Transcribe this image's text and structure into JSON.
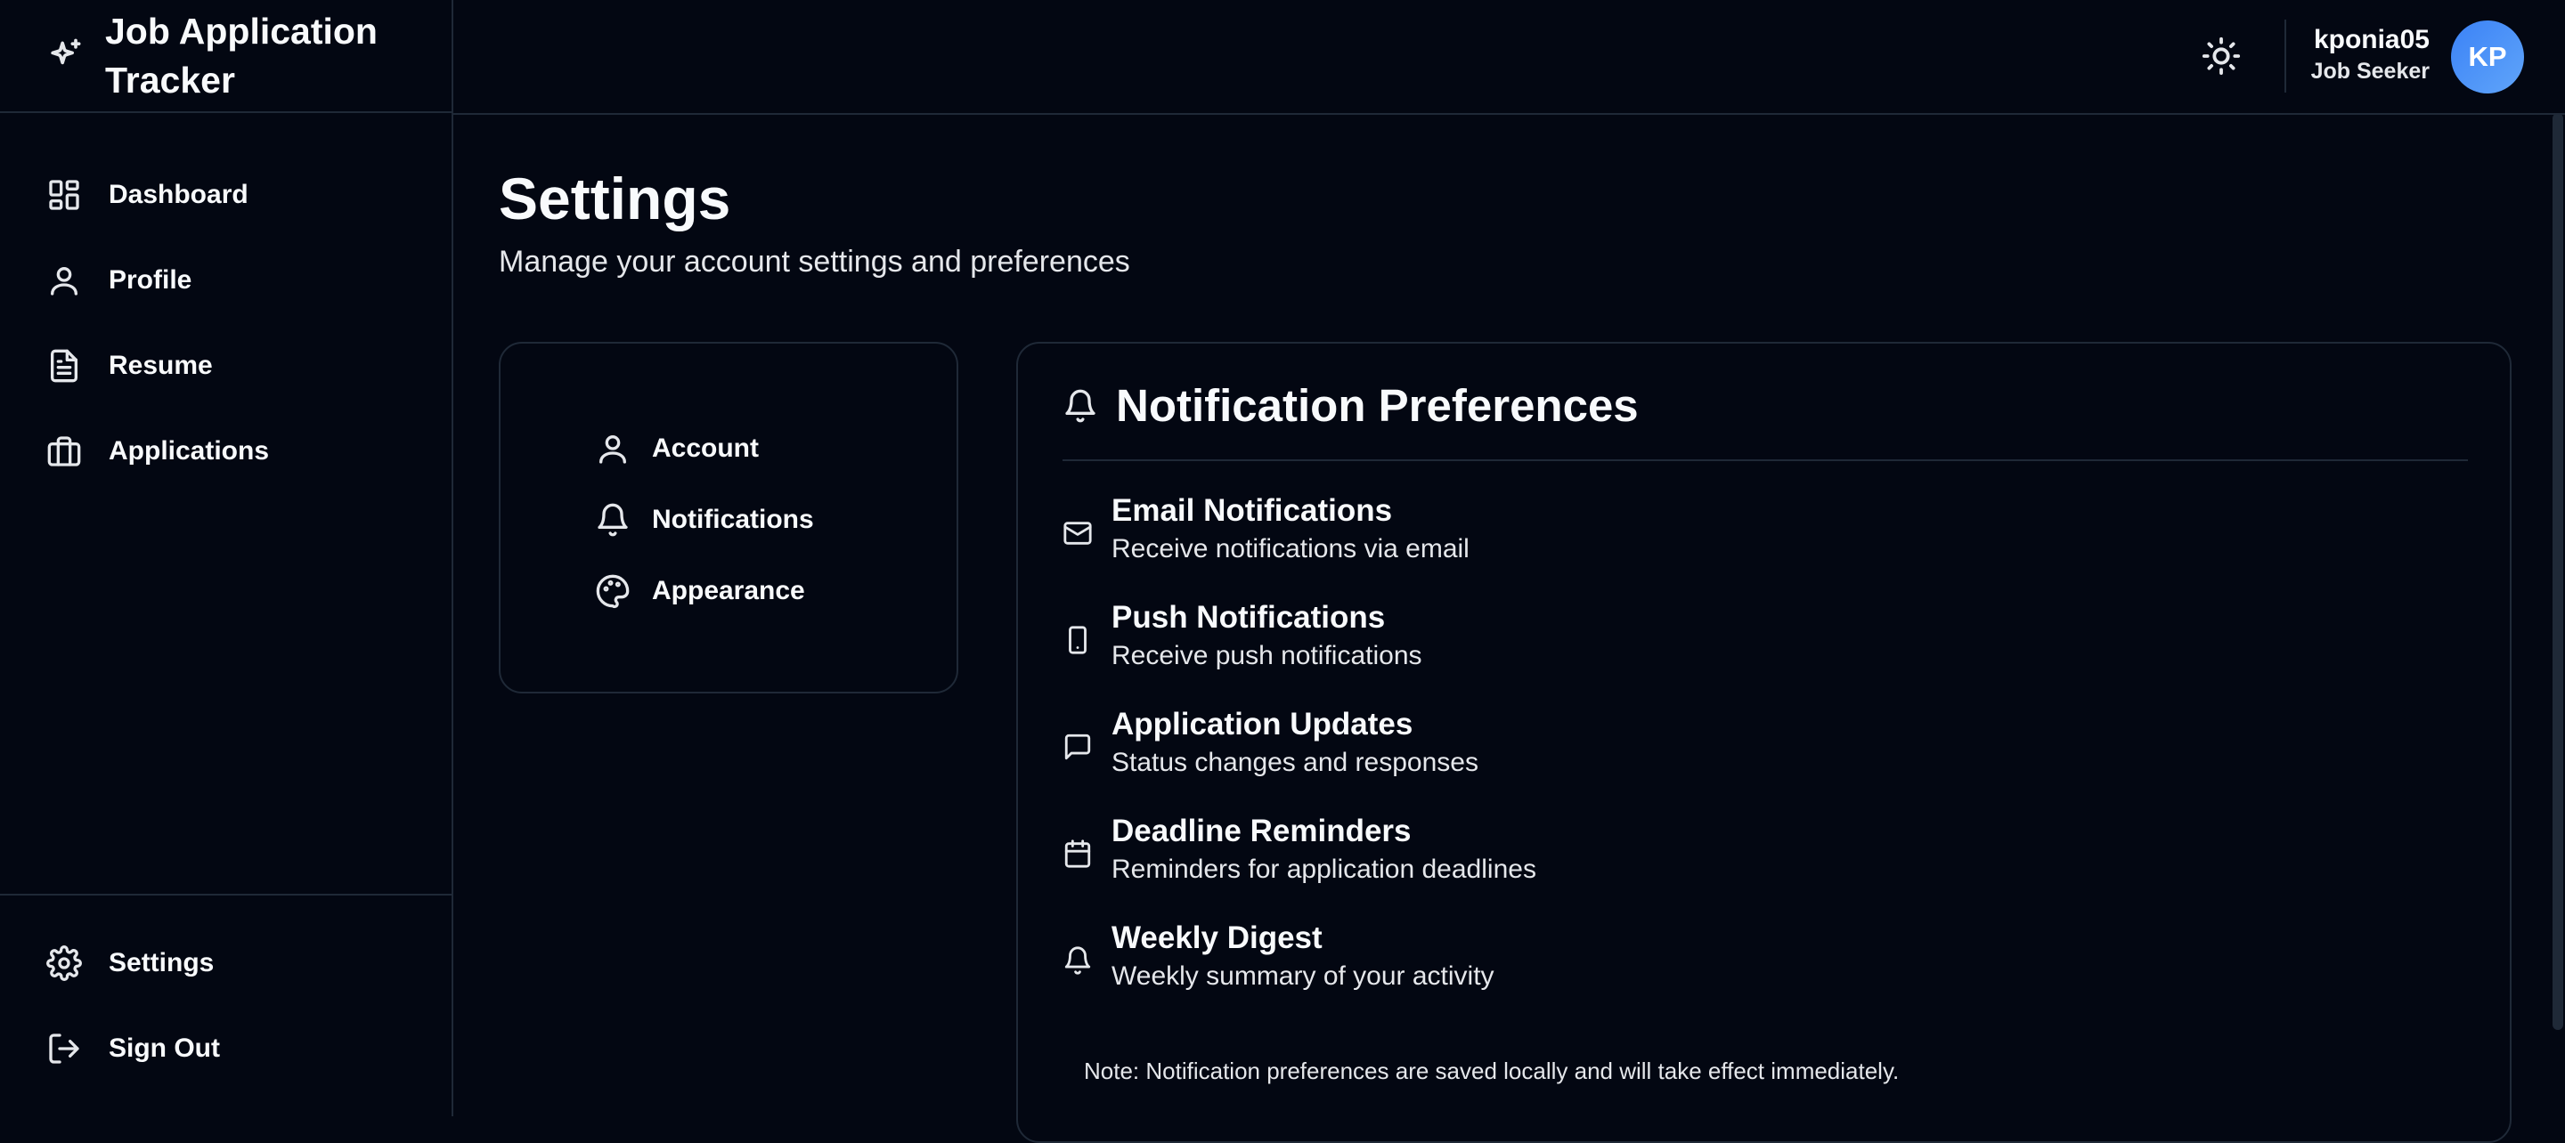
{
  "brand": {
    "title": "Job Application Tracker",
    "icon": "sparkles-icon"
  },
  "sidebar": {
    "items": [
      {
        "label": "Dashboard",
        "icon": "layout-dashboard-icon"
      },
      {
        "label": "Profile",
        "icon": "user-icon"
      },
      {
        "label": "Resume",
        "icon": "file-text-icon"
      },
      {
        "label": "Applications",
        "icon": "briefcase-icon"
      }
    ],
    "bottom": [
      {
        "label": "Settings",
        "icon": "gear-icon"
      },
      {
        "label": "Sign Out",
        "icon": "log-out-icon"
      }
    ]
  },
  "header": {
    "theme_icon": "sun-icon",
    "user": {
      "name": "kponia05",
      "role": "Job Seeker",
      "initials": "KP"
    }
  },
  "page": {
    "title": "Settings",
    "subtitle": "Manage your account settings and preferences"
  },
  "settings_menu": [
    {
      "label": "Account",
      "icon": "user-icon"
    },
    {
      "label": "Notifications",
      "icon": "bell-icon"
    },
    {
      "label": "Appearance",
      "icon": "palette-icon"
    }
  ],
  "notifications": {
    "title": "Notification Preferences",
    "items": [
      {
        "title": "Email Notifications",
        "description": "Receive notifications via email",
        "icon": "mail-icon"
      },
      {
        "title": "Push Notifications",
        "description": "Receive push notifications",
        "icon": "smartphone-icon"
      },
      {
        "title": "Application Updates",
        "description": "Status changes and responses",
        "icon": "message-square-icon"
      },
      {
        "title": "Deadline Reminders",
        "description": "Reminders for application deadlines",
        "icon": "calendar-icon"
      },
      {
        "title": "Weekly Digest",
        "description": "Weekly summary of your activity",
        "icon": "bell-icon"
      }
    ],
    "note": "Note: Notification preferences are saved locally and will take effect immediately."
  },
  "colors": {
    "background": "#030712",
    "border": "#1f2937",
    "text": "#f8fafc",
    "avatar": "#3b82f6"
  }
}
